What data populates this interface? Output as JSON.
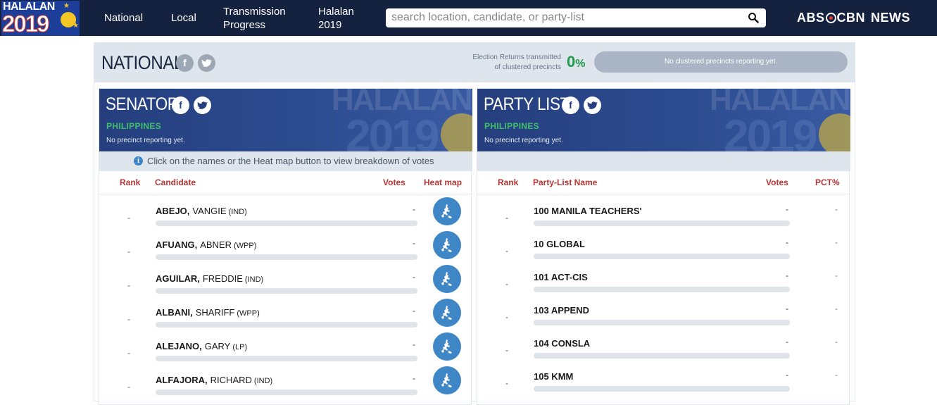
{
  "logo": {
    "line1": "HALALAN",
    "line2": "2019"
  },
  "nav": {
    "items": [
      "National",
      "Local",
      "Transmission Progress",
      "Halalan 2019"
    ],
    "items_display": [
      [
        "National"
      ],
      [
        "Local"
      ],
      [
        "Transmission",
        "Progress"
      ],
      [
        "Halalan",
        "2019"
      ]
    ]
  },
  "search": {
    "placeholder": "search location, candidate, or party-list",
    "value": ""
  },
  "brand": {
    "abs": "ABS",
    "cbn": "CBN",
    "news": "NEWS"
  },
  "national": {
    "title": "NATIONAL",
    "er_line1": "Election Returns transmitted",
    "er_line2": "of clustered precincts",
    "er_pct": "0",
    "er_pct_sign": "%",
    "progress_text": "No clustered precincts reporting yet."
  },
  "senator": {
    "title": "SENATOR",
    "location": "PHILIPPINES",
    "status": "No precinct reporting yet.",
    "info": "Click on the names or the Heat map button to view breakdown of votes",
    "columns": {
      "rank": "Rank",
      "candidate": "Candidate",
      "votes": "Votes",
      "heatmap": "Heat map"
    },
    "rows": [
      {
        "rank": "-",
        "last": "ABEJO,",
        "first": "VANGIE",
        "party": "(IND)",
        "votes": "-"
      },
      {
        "rank": "-",
        "last": "AFUANG,",
        "first": "ABNER",
        "party": "(WPP)",
        "votes": "-"
      },
      {
        "rank": "-",
        "last": "AGUILAR,",
        "first": "FREDDIE",
        "party": "(IND)",
        "votes": "-"
      },
      {
        "rank": "-",
        "last": "ALBANI,",
        "first": "SHARIFF",
        "party": "(WPP)",
        "votes": "-"
      },
      {
        "rank": "-",
        "last": "ALEJANO,",
        "first": "GARY",
        "party": "(LP)",
        "votes": "-"
      },
      {
        "rank": "-",
        "last": "ALFAJORA,",
        "first": "RICHARD",
        "party": "(IND)",
        "votes": "-"
      }
    ]
  },
  "partylist": {
    "title": "PARTY LIST",
    "location": "PHILIPPINES",
    "status": "No precinct reporting yet.",
    "columns": {
      "rank": "Rank",
      "name": "Party-List Name",
      "votes": "Votes",
      "pct": "PCT%"
    },
    "rows": [
      {
        "rank": "-",
        "name": "100 MANILA TEACHERS'",
        "votes": "-",
        "pct": "-"
      },
      {
        "rank": "-",
        "name": "10 GLOBAL",
        "votes": "-",
        "pct": "-"
      },
      {
        "rank": "-",
        "name": "101 ACT-CIS",
        "votes": "-",
        "pct": "-"
      },
      {
        "rank": "-",
        "name": "103 APPEND",
        "votes": "-",
        "pct": "-"
      },
      {
        "rank": "-",
        "name": "104 CONSLA",
        "votes": "-",
        "pct": "-"
      },
      {
        "rank": "-",
        "name": "105 KMM",
        "votes": "-",
        "pct": "-"
      }
    ]
  },
  "icons": {
    "facebook": "facebook-icon",
    "twitter": "twitter-icon",
    "search": "search-icon",
    "info": "info-icon",
    "heatmap": "heatmap-icon"
  },
  "colors": {
    "nav_bg": "#15223f",
    "panel_header": "#253f7e",
    "accent_red": "#b83232",
    "location_green": "#3fc06a",
    "heat_blue": "#3f86c6",
    "pct_green": "#1e9a4a"
  }
}
